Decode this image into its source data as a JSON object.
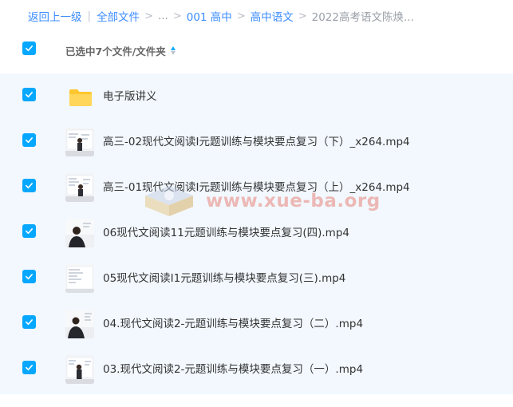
{
  "breadcrumb": {
    "back": "返回上一级",
    "separator_bar": "|",
    "items": [
      "全部文件",
      "...",
      "001 高中",
      "高中语文"
    ],
    "current": "2022高考语文陈焕...",
    "separator": ">"
  },
  "header": {
    "selection_label": "已选中7个文件/文件夹",
    "checkbox_checked": true
  },
  "files": [
    {
      "name": "电子版讲义",
      "type": "folder",
      "checked": true
    },
    {
      "name": "高三-02现代文阅读I元题训练与模块要点复习（下）_x264.mp4",
      "type": "video",
      "checked": true
    },
    {
      "name": "高三-01现代文阅读I元题训练与模块要点复习（上）_x264.mp4",
      "type": "video",
      "checked": true
    },
    {
      "name": "06现代文阅读11元题训练与模块要点复习(四).mp4",
      "type": "video",
      "checked": true
    },
    {
      "name": "05现代文阅读I1元题训练与模块要点复习(三).mp4",
      "type": "video",
      "checked": true
    },
    {
      "name": "04.现代文阅读2-元题训练与模块要点复习（二）.mp4",
      "type": "video",
      "checked": true
    },
    {
      "name": "03.现代文阅读2-元题训练与模块要点复习（一）.mp4",
      "type": "video",
      "checked": true
    }
  ],
  "watermark": {
    "text": "www.xue-ba.org"
  },
  "colors": {
    "accent": "#06a7ff",
    "link": "#3b8cff",
    "row_background": "#f2f8fe",
    "folder": "#ffc62e"
  },
  "icons": {
    "checkbox": "checkbox-checked-icon",
    "folder": "folder-icon",
    "video_thumbnail": "video-thumbnail",
    "sort": "sort-icon"
  }
}
